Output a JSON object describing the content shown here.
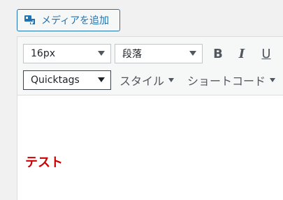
{
  "add_media": {
    "label": "メディアを追加",
    "icon": "media-icon"
  },
  "toolbar": {
    "font_size": "16px",
    "format": "段落",
    "bold": "B",
    "italic": "I",
    "underline": "U",
    "quicktags": "Quicktags",
    "style_menu": "スタイル",
    "shortcode_menu": "ショートコード"
  },
  "content": {
    "text": "テスト",
    "text_color": "#cc0000"
  },
  "colors": {
    "accent": "#2271b1"
  }
}
